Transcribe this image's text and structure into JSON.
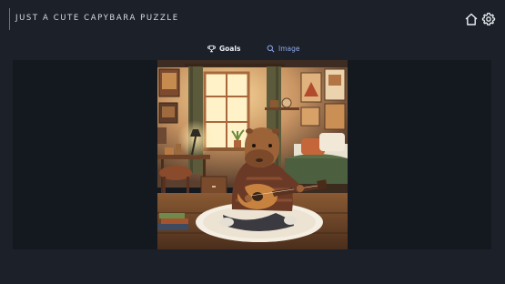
{
  "header": {
    "title": "JUST A CUTE CAPYBARA PUZZLE",
    "home_icon": "home-icon",
    "settings_icon": "gear-icon"
  },
  "tabs": [
    {
      "label": "Goals",
      "icon": "trophy-icon",
      "active": true
    },
    {
      "label": "Image",
      "icon": "search-icon",
      "active": false
    }
  ],
  "image": {
    "subject": "Capybara playing guitar in a cozy bedroom"
  },
  "colors": {
    "background": "#1c2129",
    "panel": "#141920",
    "accent": "#8fa8e8",
    "text": "#d8dde5"
  }
}
